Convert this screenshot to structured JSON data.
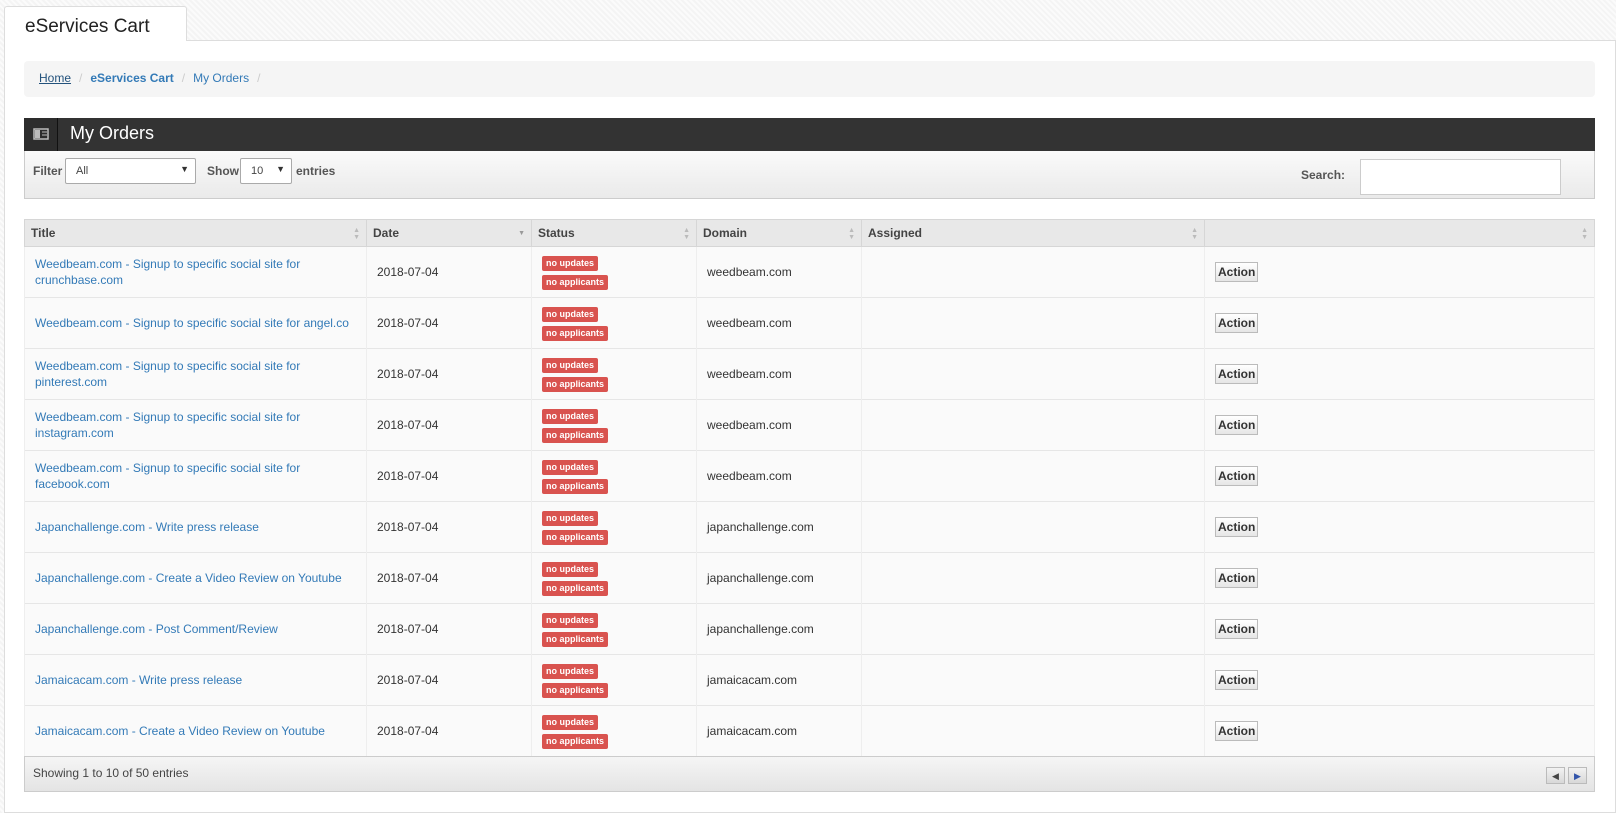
{
  "tab": {
    "label": "eServices Cart"
  },
  "breadcrumb": {
    "home": "Home",
    "section": "eServices Cart",
    "current": "My Orders"
  },
  "header": {
    "title": "My Orders"
  },
  "toolbar": {
    "filter_label": "Filter",
    "filter_value": "All",
    "show_label": "Show",
    "show_value": "10",
    "entries_label": "entries",
    "search_label": "Search:",
    "search_value": ""
  },
  "table": {
    "columns": [
      "Title",
      "Date",
      "Status",
      "Domain",
      "Assigned",
      ""
    ],
    "rows": [
      {
        "title": "Weedbeam.com - Signup to specific social site for crunchbase.com",
        "date": "2018-07-04",
        "status1": "no updates",
        "status2": "no applicants",
        "domain": "weedbeam.com",
        "assigned": "",
        "action": "Action"
      },
      {
        "title": "Weedbeam.com - Signup to specific social site for angel.co",
        "date": "2018-07-04",
        "status1": "no updates",
        "status2": "no applicants",
        "domain": "weedbeam.com",
        "assigned": "",
        "action": "Action"
      },
      {
        "title": "Weedbeam.com - Signup to specific social site for pinterest.com",
        "date": "2018-07-04",
        "status1": "no updates",
        "status2": "no applicants",
        "domain": "weedbeam.com",
        "assigned": "",
        "action": "Action"
      },
      {
        "title": "Weedbeam.com - Signup to specific social site for instagram.com",
        "date": "2018-07-04",
        "status1": "no updates",
        "status2": "no applicants",
        "domain": "weedbeam.com",
        "assigned": "",
        "action": "Action"
      },
      {
        "title": "Weedbeam.com - Signup to specific social site for facebook.com",
        "date": "2018-07-04",
        "status1": "no updates",
        "status2": "no applicants",
        "domain": "weedbeam.com",
        "assigned": "",
        "action": "Action"
      },
      {
        "title": "Japanchallenge.com - Write press release",
        "date": "2018-07-04",
        "status1": "no updates",
        "status2": "no applicants",
        "domain": "japanchallenge.com",
        "assigned": "",
        "action": "Action"
      },
      {
        "title": "Japanchallenge.com - Create a Video Review on Youtube",
        "date": "2018-07-04",
        "status1": "no updates",
        "status2": "no applicants",
        "domain": "japanchallenge.com",
        "assigned": "",
        "action": "Action"
      },
      {
        "title": "Japanchallenge.com - Post Comment/Review",
        "date": "2018-07-04",
        "status1": "no updates",
        "status2": "no applicants",
        "domain": "japanchallenge.com",
        "assigned": "",
        "action": "Action"
      },
      {
        "title": "Jamaicacam.com - Write press release",
        "date": "2018-07-04",
        "status1": "no updates",
        "status2": "no applicants",
        "domain": "jamaicacam.com",
        "assigned": "",
        "action": "Action"
      },
      {
        "title": "Jamaicacam.com - Create a Video Review on Youtube",
        "date": "2018-07-04",
        "status1": "no updates",
        "status2": "no applicants",
        "domain": "jamaicacam.com",
        "assigned": "",
        "action": "Action"
      }
    ]
  },
  "footer": {
    "info": "Showing 1 to 10 of 50 entries"
  },
  "colors": {
    "link": "#337ab7",
    "badge": "#d9534f",
    "header_bg": "#333333"
  },
  "icons": {
    "header": "list-icon",
    "prev": "previous-page-icon",
    "next": "next-page-icon"
  }
}
